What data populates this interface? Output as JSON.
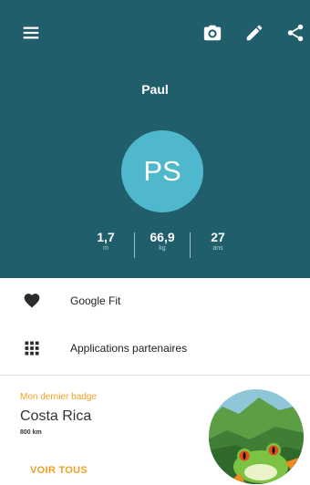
{
  "profile": {
    "name": "Paul",
    "initials": "PS",
    "stats": {
      "height": {
        "value": "1,7",
        "unit": "m"
      },
      "weight": {
        "value": "66,9",
        "unit": "kg"
      },
      "age": {
        "value": "27",
        "unit": "ans"
      }
    }
  },
  "toolbar": {
    "icons": [
      "menu-icon",
      "camera-icon",
      "edit-icon",
      "share-icon"
    ]
  },
  "menu": {
    "items": [
      {
        "label": "Google Fit",
        "icon": "heart-icon"
      },
      {
        "label": "Applications partenaires",
        "icon": "grid-icon"
      }
    ]
  },
  "badge": {
    "title": "Mon dernier badge",
    "name": "Costa Rica",
    "distance": "800 km",
    "see_all": "VOIR TOUS"
  },
  "colors": {
    "header_bg": "#1f5e6a",
    "avatar_bg": "#4fb8cc",
    "accent": "#f2a024"
  }
}
